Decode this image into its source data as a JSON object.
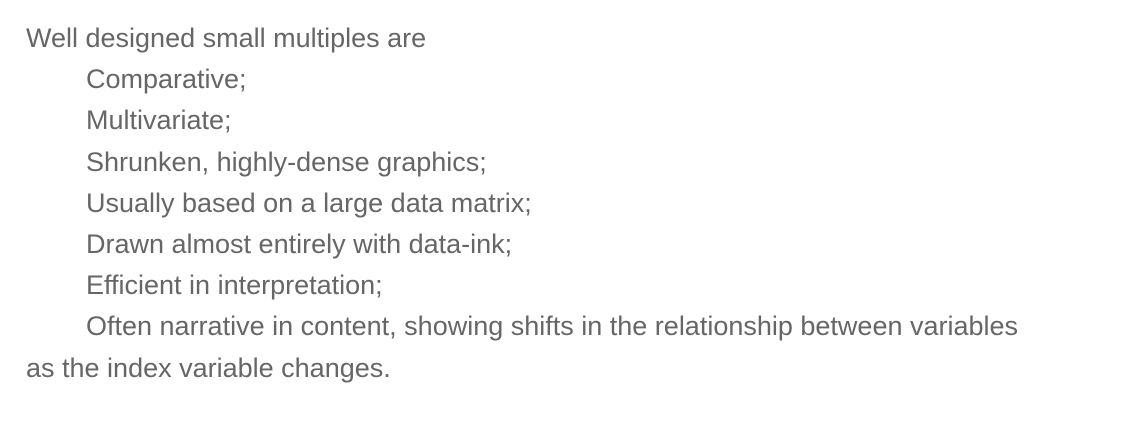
{
  "document": {
    "intro": "Well designed small multiples are",
    "items": [
      "Comparative;",
      "Multivariate;",
      "Shrunken, highly-dense graphics;",
      "Usually based on a large data matrix;",
      "Drawn almost entirely with data-ink;",
      "Efficient in interpretation;"
    ],
    "last_item_line1": "Often narrative in content, showing shifts in the relationship between variables",
    "last_item_line2": "as the index variable changes."
  },
  "colors": {
    "text": "#666666",
    "background": "#ffffff"
  }
}
